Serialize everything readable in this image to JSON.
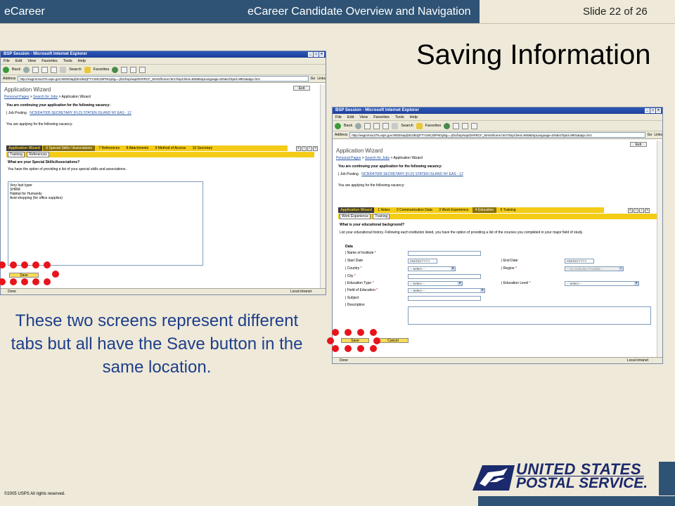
{
  "header": {
    "brand": "eCareer",
    "course_title": "eCareer Candidate Overview and Navigation",
    "slide_number": "Slide 22 of 26"
  },
  "title": "Saving Information",
  "caption": "These two screens represent different tabs but all have the Save button in the same location.",
  "copyright": "©2005 USPS All rights reserved.",
  "logo": {
    "line1": "UNITED STATES",
    "line2": "POSTAL SERVICE."
  },
  "browser": {
    "window_title": "BSP Session - Microsoft Internet Explorer",
    "menu": [
      "File",
      "Edit",
      "View",
      "Favorites",
      "Tools",
      "Help"
    ],
    "toolbar": {
      "back": "Back",
      "search": "Search",
      "favorites": "Favorites"
    },
    "address_label": "Address",
    "address_url": "http://eagmmsu379.usps.gov:8000/sap(bD1lbiZjPTY1MCZkPW1pbg==)/bc/bsp/sap/ZHRRCF_MAIN/home.htm?bspClient=650&bspLanguage=EN&rcfSpId=9901&app=hrrc",
    "go": "Go",
    "links": "Links",
    "status_done": "Done",
    "status_zone": "Local intranet"
  },
  "app": {
    "title": "Application Wizard",
    "crumb_personal": "Personal Pages",
    "crumb_search": "Search for Jobs",
    "crumb_current": "> Application Wizard",
    "exit": "Exit",
    "continuing": "You are continuing your application for the following vacancy:",
    "job_label": "Job Posting",
    "job_link": "NC50047005 SECRETARY (FLD) STATEN ISLAND NY EAS - 12",
    "applying": "You are applying for the following vacancy:"
  },
  "screen1": {
    "steps_current": "Application Wizard",
    "steps": [
      "6  Special Skills / Associations",
      "7  References",
      "8  Attachments",
      "9  Method of Access",
      "10  Secretary"
    ],
    "subtabs": [
      "Training",
      "References"
    ],
    "question": "What are your Special Skills/Associations?",
    "hint": "You have the option of providing a list of your special skills and associations.",
    "skills": [
      "Very fast typer",
      "SHRM",
      "Habitat for Humanity",
      "Avid shopping (for office supplies)"
    ],
    "save": "Save"
  },
  "screen2": {
    "steps_current": "Application Wizard",
    "steps": [
      "1  Notes",
      "2  Communication Data",
      "3  Work Experience",
      "4  Education",
      "5  Training"
    ],
    "subtabs": [
      "Work Experience",
      "Training"
    ],
    "question": "What is your educational background?",
    "hint": "List your educational history. Following each institution listed, you have the option of providing a list of the courses you completed in your major field of study.",
    "section": "Data",
    "fields": {
      "institute": "Name of Institute",
      "start_date": "Start Date",
      "end_date": "End Date",
      "country": "Country",
      "region": "Region",
      "city": "City",
      "edu_type": "Education Type",
      "edu_level": "Education Level",
      "field": "Field of Education",
      "subject": "Subject",
      "description": "Description"
    },
    "date_placeholder": "MM/DD/YYYY",
    "select_placeholder": "-- Select --",
    "no_selection": "-- No Selection Possible --",
    "save": "Save",
    "cancel": "Cancel"
  }
}
